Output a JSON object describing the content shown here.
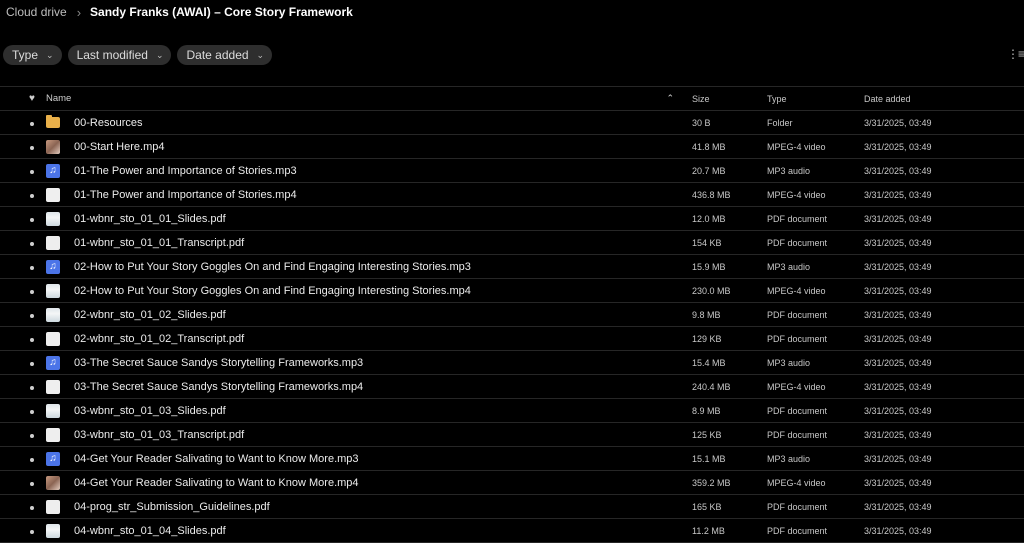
{
  "breadcrumb": {
    "root": "Cloud drive",
    "separator": "›",
    "current": "Sandy Franks (AWAI) – Core Story Framework"
  },
  "filters": [
    {
      "label": "Type"
    },
    {
      "label": "Last modified"
    },
    {
      "label": "Date added"
    }
  ],
  "view_toggle_icon": "list-view-icon",
  "columns": {
    "favorite_icon": "heart-icon",
    "name": "Name",
    "sort_indicator": "^",
    "size": "Size",
    "type": "Type",
    "date_added": "Date added"
  },
  "files": [
    {
      "icon": "folder",
      "name": "00-Resources",
      "size": "30 B",
      "type": "Folder",
      "date": "3/31/2025, 03:49"
    },
    {
      "icon": "video-thumb",
      "name": "00-Start Here.mp4",
      "size": "41.8 MB",
      "type": "MPEG-4 video",
      "date": "3/31/2025, 03:49"
    },
    {
      "icon": "audio",
      "name": "01-The Power and Importance of Stories.mp3",
      "size": "20.7 MB",
      "type": "MP3 audio",
      "date": "3/31/2025, 03:49"
    },
    {
      "icon": "video",
      "name": "01-The Power and Importance of Stories.mp4",
      "size": "436.8 MB",
      "type": "MPEG-4 video",
      "date": "3/31/2025, 03:49"
    },
    {
      "icon": "slide",
      "name": "01-wbnr_sto_01_01_Slides.pdf",
      "size": "12.0 MB",
      "type": "PDF document",
      "date": "3/31/2025, 03:49"
    },
    {
      "icon": "pdf",
      "name": "01-wbnr_sto_01_01_Transcript.pdf",
      "size": "154 KB",
      "type": "PDF document",
      "date": "3/31/2025, 03:49"
    },
    {
      "icon": "audio",
      "name": "02-How to Put Your Story Goggles On and Find Engaging Interesting Stories.mp3",
      "size": "15.9 MB",
      "type": "MP3 audio",
      "date": "3/31/2025, 03:49"
    },
    {
      "icon": "slide",
      "name": "02-How to Put Your Story Goggles On and Find Engaging Interesting Stories.mp4",
      "size": "230.0 MB",
      "type": "MPEG-4 video",
      "date": "3/31/2025, 03:49"
    },
    {
      "icon": "slide",
      "name": "02-wbnr_sto_01_02_Slides.pdf",
      "size": "9.8 MB",
      "type": "PDF document",
      "date": "3/31/2025, 03:49"
    },
    {
      "icon": "pdf",
      "name": "02-wbnr_sto_01_02_Transcript.pdf",
      "size": "129 KB",
      "type": "PDF document",
      "date": "3/31/2025, 03:49"
    },
    {
      "icon": "audio",
      "name": "03-The Secret Sauce Sandys Storytelling Frameworks.mp3",
      "size": "15.4 MB",
      "type": "MP3 audio",
      "date": "3/31/2025, 03:49"
    },
    {
      "icon": "video",
      "name": "03-The Secret Sauce Sandys Storytelling Frameworks.mp4",
      "size": "240.4 MB",
      "type": "MPEG-4 video",
      "date": "3/31/2025, 03:49"
    },
    {
      "icon": "slide",
      "name": "03-wbnr_sto_01_03_Slides.pdf",
      "size": "8.9 MB",
      "type": "PDF document",
      "date": "3/31/2025, 03:49"
    },
    {
      "icon": "pdf",
      "name": "03-wbnr_sto_01_03_Transcript.pdf",
      "size": "125 KB",
      "type": "PDF document",
      "date": "3/31/2025, 03:49"
    },
    {
      "icon": "audio",
      "name": "04-Get Your Reader Salivating to Want to Know More.mp3",
      "size": "15.1 MB",
      "type": "MP3 audio",
      "date": "3/31/2025, 03:49"
    },
    {
      "icon": "video-thumb",
      "name": "04-Get Your Reader Salivating to Want to Know More.mp4",
      "size": "359.2 MB",
      "type": "MPEG-4 video",
      "date": "3/31/2025, 03:49"
    },
    {
      "icon": "pdf",
      "name": "04-prog_str_Submission_Guidelines.pdf",
      "size": "165 KB",
      "type": "PDF document",
      "date": "3/31/2025, 03:49"
    },
    {
      "icon": "slide",
      "name": "04-wbnr_sto_01_04_Slides.pdf",
      "size": "11.2 MB",
      "type": "PDF document",
      "date": "3/31/2025, 03:49"
    }
  ]
}
